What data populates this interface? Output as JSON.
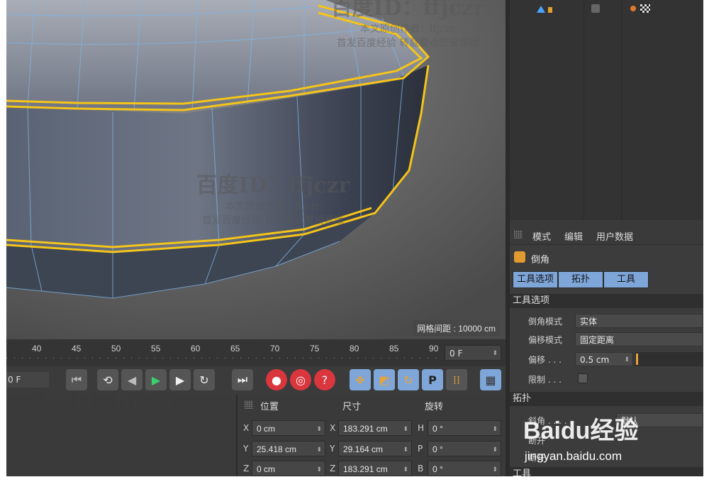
{
  "viewport": {
    "grid_spacing": "网格间距 : 10000 cm"
  },
  "timeline": {
    "ticks": [
      "40",
      "45",
      "50",
      "55",
      "60",
      "65",
      "70",
      "75",
      "80",
      "85",
      "90"
    ],
    "current_frame": "0 F",
    "left_frame": "0 F"
  },
  "transport": {
    "icons": [
      "go-start-icon",
      "loop-icon",
      "step-back-icon",
      "play-icon",
      "step-forward-icon",
      "record-loop-icon",
      "go-end-icon",
      "record-icon",
      "autokey-icon",
      "help-icon",
      "move-icon",
      "scale-icon",
      "rotate-icon",
      "param-icon",
      "points-icon",
      "film-icon"
    ]
  },
  "attributes": {
    "menu": [
      "模式",
      "编辑",
      "用户数据"
    ],
    "tool_name": "倒角",
    "tabs": [
      "工具选项",
      "拓扑",
      "工具"
    ],
    "section_tool_options": "工具选项",
    "bevel_mode_label": "倒角模式",
    "bevel_mode_value": "实体",
    "offset_mode_label": "偏移模式",
    "offset_mode_value": "固定距离",
    "offset_label": "偏移 . . .",
    "offset_value": "0.5 cm",
    "limit_label": "限制 . . .",
    "section_topology": "拓扑",
    "miter_label": "斜角 . . . . .",
    "miter_value": "默认",
    "row_a_label": "断开",
    "row_b_label": "断开",
    "section_next": "工具"
  },
  "coordinates": {
    "head_position": "位置",
    "head_size": "尺寸",
    "head_rotation": "旋转",
    "rows": [
      {
        "p_axis": "X",
        "p": "0 cm",
        "s_axis": "X",
        "s": "183.291 cm",
        "r_axis": "H",
        "r": "0 °"
      },
      {
        "p_axis": "Y",
        "p": "25.418 cm",
        "s_axis": "Y",
        "s": "29.164 cm",
        "r_axis": "P",
        "r": "0 °"
      },
      {
        "p_axis": "Z",
        "p": "0 cm",
        "s_axis": "Z",
        "s": "183.291 cm",
        "r_axis": "B",
        "r": "0 °"
      }
    ]
  },
  "watermarks": {
    "id_line": "百度ID：ffjczr",
    "author_line": "本文原创作者：ffjczr",
    "publish_line": "首发百度经验 转载要点赞投票哦",
    "baidu_logo": "Baidu经验",
    "baidu_url": "jingyan.baidu.com"
  },
  "colors": {
    "selection_yellow": "#f5c518",
    "active_tab": "#7fa6d9",
    "mesh_wire": "#7fb3e6",
    "red_btn": "#d9363e",
    "orange_btn": "#e8a33a"
  }
}
